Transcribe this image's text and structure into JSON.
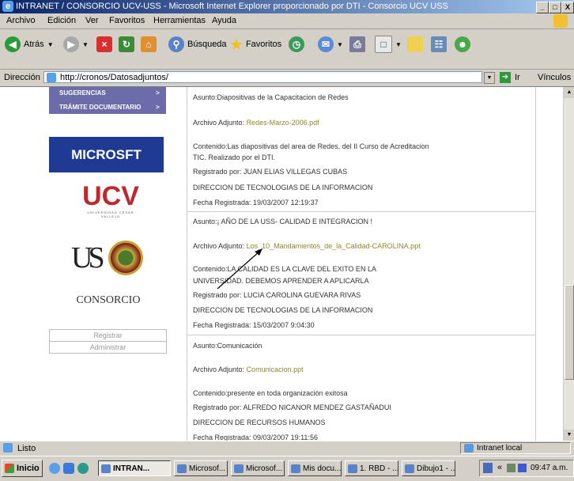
{
  "window": {
    "title": "INTRANET / CONSORCIO UCV-USS - Microsoft Internet Explorer proporcionado por DTI - Consorcio UCV USS",
    "min_label": "_",
    "max_label": "□",
    "close_label": "X"
  },
  "menu": [
    "Archivo",
    "Edición",
    "Ver",
    "Favoritos",
    "Herramientas",
    "Ayuda"
  ],
  "toolbar": {
    "back_label": "Atrás",
    "search_label": "Búsqueda",
    "favorites_label": "Favoritos"
  },
  "address": {
    "label": "Dirección",
    "url": "http://cronos/Datosadjuntos/",
    "go_label": "Ir",
    "links_label": "Vínculos"
  },
  "sidebar": {
    "items": [
      "SUGERENCIAS",
      "TRÁMITE DOCUMENTARIO"
    ],
    "arrow": ">",
    "microsoft_banner": "MICROSFT",
    "ucv_logo_text": "UCV",
    "ucv_logo_sub": "UNIVERSIDAD CÉSAR VALLEJO",
    "uss_logo_text": "US",
    "consorcio_text": "CONSORCIO",
    "links": [
      "Registrar",
      "Administrar"
    ]
  },
  "entries": [
    {
      "asunto": "Asunto:Diapositivas de la Capacitacion de Redes",
      "archivo_label": "Archivo Adjunto:",
      "archivo": "Redes-Marzo-2006.pdf",
      "contenido_1": "Contenido:Las diapositivas del area de Redes, del II Curso de Acreditacion",
      "contenido_2": "TIC. Realizado por el DTI.",
      "registrado": "Registrado por: JUAN ELIAS VILLEGAS CUBAS",
      "area": "DIRECCION DE TECNOLOGIAS DE LA INFORMACION",
      "fecha": "Fecha Registrada: 19/03/2007 12:19:37"
    },
    {
      "asunto": "Asunto:¡ AÑO DE LA USS- CALIDAD E INTEGRACION !",
      "archivo_label": "Archivo Adjunto:",
      "archivo": "Los_10_Mandamientos_de_la_Calidad-CAROLINA.ppt",
      "contenido_1": "Contenido:LA CALIDAD ES LA CLAVE DEL EXITO EN LA",
      "contenido_2": "UNIVERSIDAD. DEBEMOS APRENDER A APLICARLA",
      "registrado": "Registrado por: LUCIA CAROLINA GUEVARA RIVAS",
      "area": "DIRECCION DE TECNOLOGIAS DE LA INFORMACION",
      "fecha": "Fecha Registrada: 15/03/2007 9:04:30"
    },
    {
      "asunto": "Asunto:Comunicación",
      "archivo_label": "Archivo Adjunto:",
      "archivo": "Comunicacion.ppt",
      "contenido_1": "Contenido:presente en toda organización exitosa",
      "contenido_2": "",
      "registrado": "Registrado por: ALFREDO NICANOR MENDEZ GASTAÑADUI",
      "area": "DIRECCION DE RECURSOS HUMANOS",
      "fecha": "Fecha Registrada: 09/03/2007 19:11:56"
    }
  ],
  "status": {
    "left": "Listo",
    "zone": "Intranet local"
  },
  "taskbar": {
    "start": "Inicio",
    "tasks": [
      "INTRAN...",
      "Microsof...",
      "Microsof...",
      "Mis docu...",
      "1. RBD - ...",
      "Dibujo1 - ..."
    ],
    "tray_chevron": "«",
    "clock": "09:47 a.m."
  },
  "colors": {
    "title_gradient_start": "#0a246a",
    "nav_bg": "#6c6cab",
    "microsoft_banner_bg": "#1f3a93",
    "attachment_link": "#8a8a2a",
    "ucv_red": "#c0282d"
  }
}
